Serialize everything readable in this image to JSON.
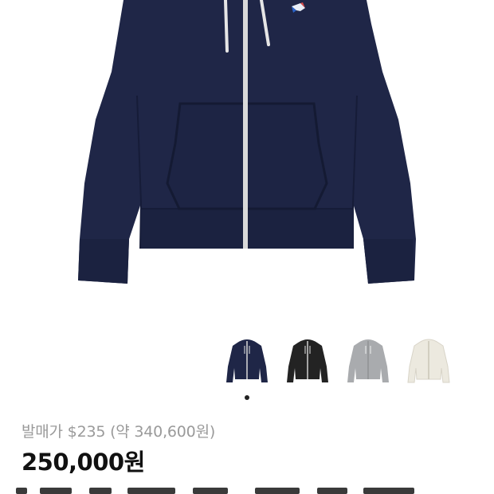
{
  "product": {
    "hero_image": "navy-zip-hoodie-photo",
    "variants": [
      {
        "name": "navy",
        "color": "#1f2647"
      },
      {
        "name": "black",
        "color": "#232323"
      },
      {
        "name": "grey",
        "color": "#a9abae"
      },
      {
        "name": "ecru",
        "color": "#ece9df"
      }
    ],
    "selected_variant_index": 0
  },
  "pricing": {
    "release_price": "발매가 $235 (약 340,600원)",
    "price": "250,000원"
  },
  "colors": {
    "garment_navy": "#1f2647",
    "release_text": "#9a9a9a",
    "price_text": "#111111"
  }
}
